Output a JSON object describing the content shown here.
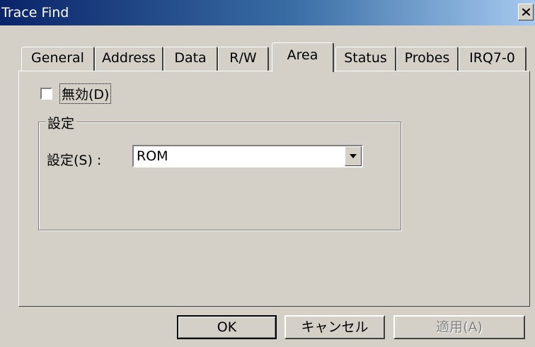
{
  "window": {
    "title": "Trace Find",
    "close_label": "×"
  },
  "tabs": [
    {
      "label": "General",
      "active": false
    },
    {
      "label": "Address",
      "active": false
    },
    {
      "label": "Data",
      "active": false
    },
    {
      "label": "R/W",
      "active": false
    },
    {
      "label": "Area",
      "active": true
    },
    {
      "label": "Status",
      "active": false
    },
    {
      "label": "Probes",
      "active": false
    },
    {
      "label": "IRQ7-0",
      "active": false
    }
  ],
  "disable_checkbox": {
    "label": "無効(D)",
    "checked": false
  },
  "settings_group": {
    "title": "設定",
    "field_label": "設定(S) :",
    "selected_value": "ROM"
  },
  "buttons": {
    "ok": "OK",
    "cancel": "キャンセル",
    "apply": "適用(A)"
  }
}
